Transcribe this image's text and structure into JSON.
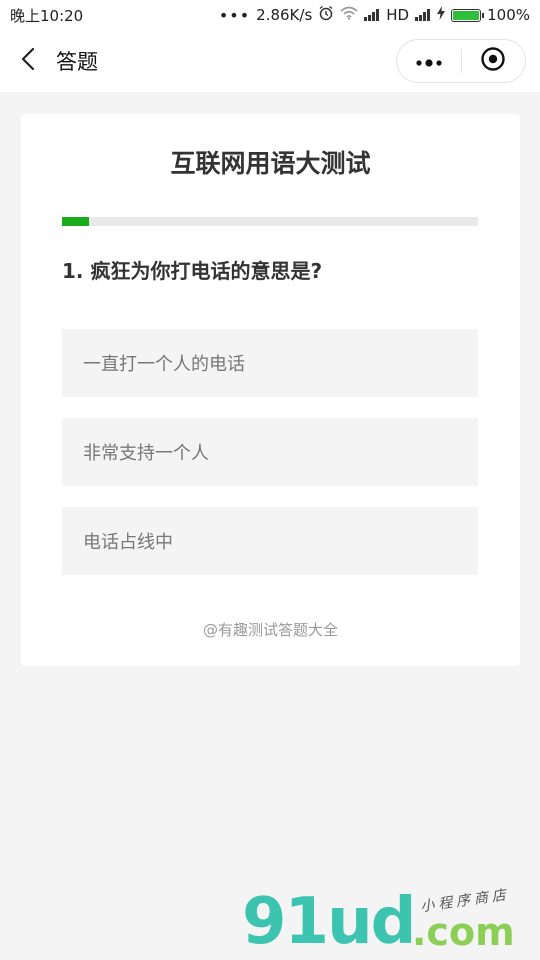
{
  "status_bar": {
    "time": "晚上10:20",
    "dots": "•••",
    "speed": "2.86K/s",
    "network": "HD",
    "battery_percent": "100%",
    "battery_level": 1.0,
    "icons": [
      "alarm-clock-icon",
      "wifi-icon",
      "signal-icon",
      "bolt-icon",
      "battery-icon"
    ]
  },
  "nav": {
    "title": "答题",
    "icons": [
      "back-arrow-icon",
      "more-dots-icon",
      "close-target-icon"
    ]
  },
  "quiz": {
    "title": "互联网用语大测试",
    "progress": 0.065,
    "question": "1. 疯狂为你打电话的意思是?",
    "options": [
      "一直打一个人的电话",
      "非常支持一个人",
      "电话占线中"
    ],
    "footer": "@有趣测试答题大全"
  },
  "watermark": {
    "logo": "91ud",
    "suffix": ".com",
    "tagline": "小程序商店"
  },
  "colors": {
    "accent_green": "#1aad19",
    "page_background": "#f4f4f4",
    "option_background": "#f4f4f4",
    "watermark_teal": "#3cc4b0",
    "watermark_lime": "#8ccf57"
  }
}
